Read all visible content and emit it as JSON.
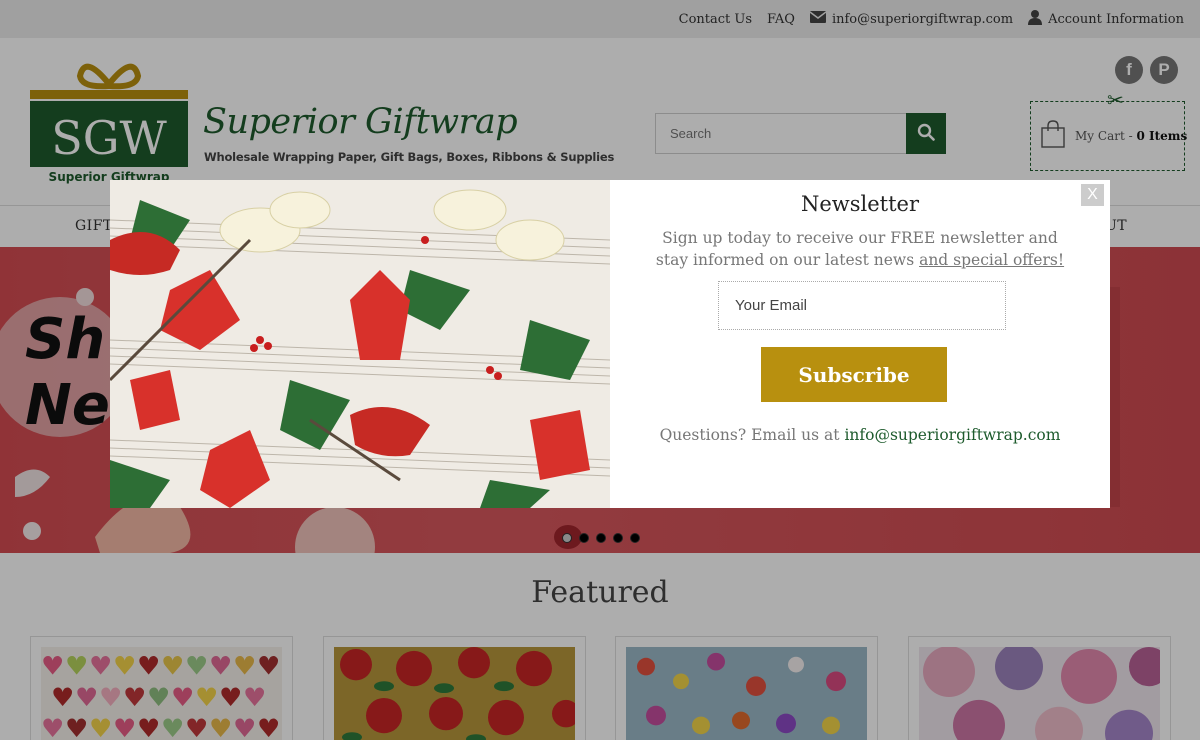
{
  "topbar": {
    "contact": "Contact Us",
    "faq": "FAQ",
    "email": "info@superiorgiftwrap.com",
    "account": "Account Information"
  },
  "header": {
    "logo_text": "SGW",
    "logo_sub": "Superior Giftwrap",
    "brand_name": "Superior Giftwrap",
    "tagline": "Wholesale Wrapping Paper, Gift Bags, Boxes, Ribbons & Supplies",
    "search_placeholder": "Search",
    "cart_label": "My Cart - ",
    "cart_items": "0 Items"
  },
  "nav": {
    "left_fragment": "GIFT",
    "right_fragment": "UT"
  },
  "hero": {
    "line1": "Sh",
    "line2": "Ne"
  },
  "featured": {
    "title": "Featured"
  },
  "modal": {
    "title": "Newsletter",
    "desc_main": "Sign up today to receive our FREE newsletter and stay informed on our latest news ",
    "desc_link": "and special offers!",
    "email_placeholder": "Your Email",
    "subscribe": "Subscribe",
    "foot_text": "Questions? Email us at ",
    "foot_email": "info@superiorgiftwrap.com",
    "close": "X"
  },
  "colors": {
    "brand_green": "#1e5b2d",
    "gold": "#b8900f",
    "hero_red": "#d44c52"
  },
  "icons": [
    "envelope-icon",
    "user-icon",
    "search-icon",
    "facebook-icon",
    "pinterest-icon",
    "scissors-icon",
    "shopping-bag-icon",
    "close-icon"
  ]
}
